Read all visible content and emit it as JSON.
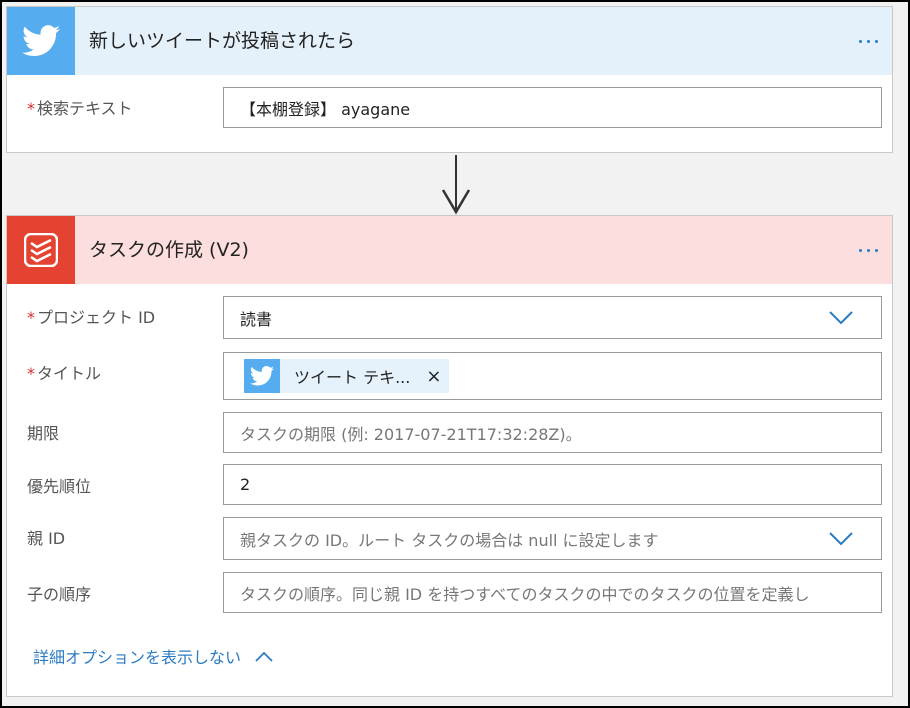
{
  "trigger": {
    "title": "新しいツイートが投稿されたら",
    "fields": {
      "search_label": "検索テキスト",
      "search_value": "【本棚登録】 ayagane"
    }
  },
  "action": {
    "title": "タスクの作成 (V2)",
    "fields": {
      "project_label": "プロジェクト ID",
      "project_value": "読書",
      "title_label": "タイトル",
      "title_token": "ツイート テキ...",
      "token_close": "×",
      "due_label": "期限",
      "due_placeholder": "タスクの期限 (例: 2017-07-21T17:32:28Z)。",
      "priority_label": "優先順位",
      "priority_value": "2",
      "parent_label": "親 ID",
      "parent_placeholder": "親タスクの ID。ルート タスクの場合は null に設定します",
      "order_label": "子の順序",
      "order_placeholder": "タスクの順序。同じ親 ID を持つすべてのタスクの中でのタスクの位置を定義し"
    },
    "advanced_toggle": "詳細オプションを表示しない"
  },
  "required_marker": "*",
  "colors": {
    "twitter": "#55acee",
    "todoist": "#e44332",
    "trigger_header": "#e5f1fa",
    "action_header": "#fbdedd",
    "link": "#2b7bc3"
  }
}
